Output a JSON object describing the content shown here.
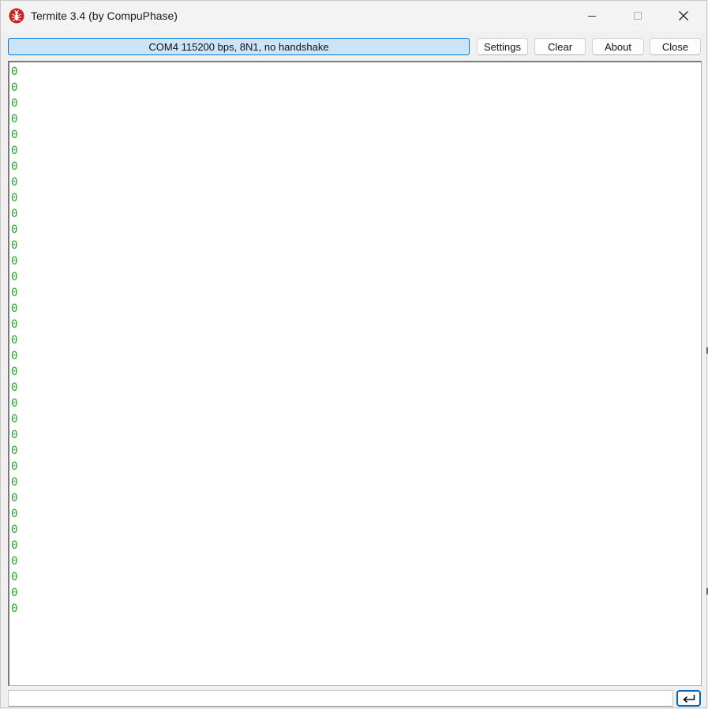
{
  "window": {
    "title": "Termite 3.4 (by CompuPhase)",
    "icon": "termite-app-icon"
  },
  "toolbar": {
    "status": "COM4 115200 bps, 8N1, no handshake",
    "settings_label": "Settings",
    "clear_label": "Clear",
    "about_label": "About",
    "close_label": "Close"
  },
  "terminal": {
    "text_color": "#22a822",
    "lines": [
      "0",
      "0",
      "0",
      "0",
      "0",
      "0",
      "0",
      "0",
      "0",
      "0",
      "0",
      "0",
      "0",
      "0",
      "0",
      "0",
      "0",
      "0",
      "0",
      "0",
      "0",
      "0",
      "0",
      "0",
      "0",
      "0",
      "0",
      "0",
      "0",
      "0",
      "0",
      "0",
      "0",
      "0",
      "0"
    ]
  },
  "input": {
    "value": "",
    "send_icon": "enter-return-icon"
  },
  "colors": {
    "status_fill": "#cce4f7",
    "status_border": "#0078d4",
    "send_border": "#0067c0"
  }
}
